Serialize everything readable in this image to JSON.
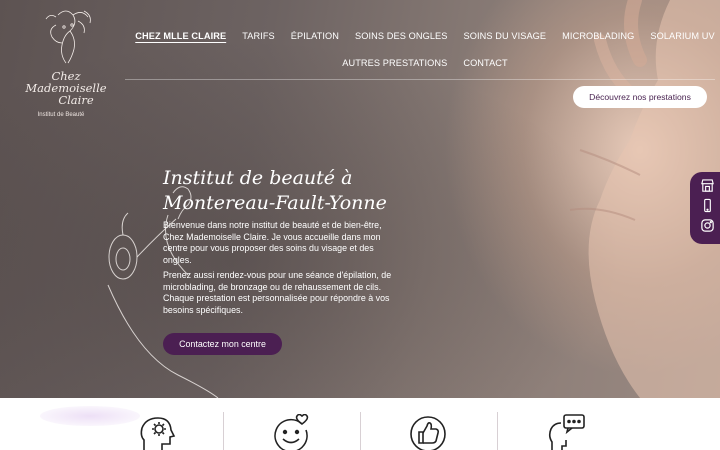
{
  "logo": {
    "name_line1": "Chez Mademoiselle",
    "name_line2": "Claire",
    "tagline": "Institut de Beauté"
  },
  "nav": {
    "row1": [
      "CHEZ MLLE CLAIRE",
      "TARIFS",
      "ÉPILATION",
      "SOINS DES ONGLES",
      "SOINS DU VISAGE",
      "MICROBLADING",
      "SOLARIUM UV"
    ],
    "row2": [
      "AUTRES PRESTATIONS",
      "CONTACT"
    ],
    "active": "CHEZ MLLE CLAIRE"
  },
  "header": {
    "cta_label": "Découvrez nos prestations"
  },
  "hero": {
    "title_line1": "Institut de beauté à",
    "title_line2": "Montereau-Fault-Yonne",
    "paragraph1": "Bienvenue dans notre institut de beauté et de bien-être, Chez Mademoiselle Claire. Je vous accueille dans mon centre pour vous proposer des soins du visage et des ongles.",
    "paragraph2": "Prenez aussi rendez-vous pour une séance d'épilation, de microblading, de bronzage ou de rehaussement de cils. Chaque prestation est personnalisée pour répondre à vos besoins spécifiques.",
    "cta_label": "Contactez mon centre"
  },
  "side_tab": {
    "icons": [
      "storefront-icon",
      "mobile-phone-icon",
      "instagram-icon"
    ]
  },
  "features": {
    "icons": [
      "head-gear-icon",
      "smiley-heart-icon",
      "thumbs-up-icon",
      "speech-bubble-head-icon"
    ]
  },
  "colors": {
    "brand_purple": "#4b1f52",
    "text_on_hero": "#ffffff"
  }
}
